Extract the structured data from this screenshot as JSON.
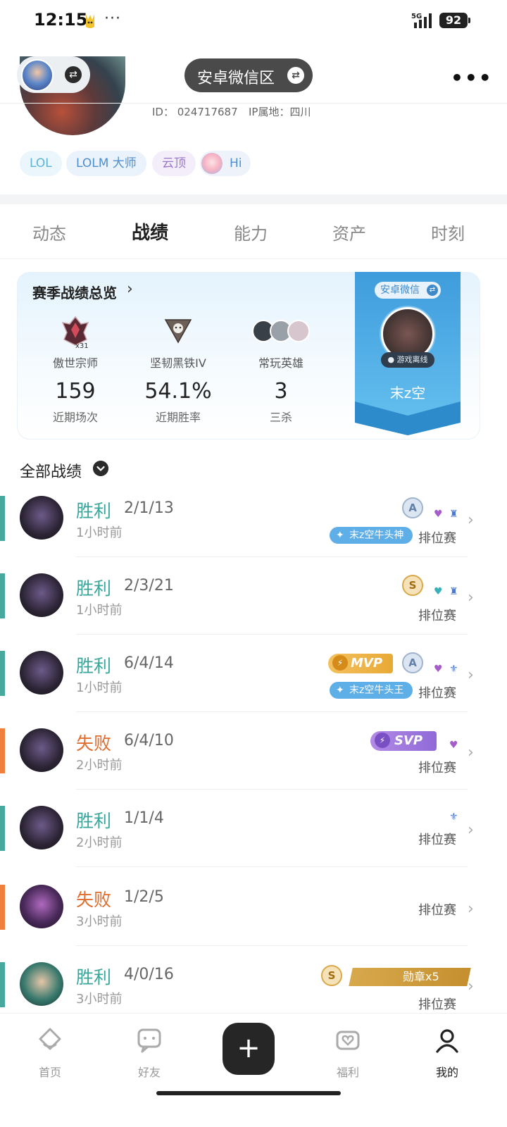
{
  "status_bar": {
    "time": "12:15",
    "dots": "···",
    "network": "5G",
    "battery": "92"
  },
  "header": {
    "region": "安卓微信区",
    "switch_icon": "swap-icon",
    "more": "•••",
    "id_text": "ID： 024717687",
    "ip_text": "IP属地：四川"
  },
  "tags": [
    {
      "label": "LOL"
    },
    {
      "label": "LOLM 大师"
    },
    {
      "label": "云顶"
    },
    {
      "label": "Hi"
    }
  ],
  "tabs": [
    {
      "label": "动态",
      "active": false
    },
    {
      "label": "战绩",
      "active": true
    },
    {
      "label": "能力",
      "active": false
    },
    {
      "label": "资产",
      "active": false
    },
    {
      "label": "时刻",
      "active": false
    }
  ],
  "season": {
    "title": "赛季战绩总览",
    "arrow": "›",
    "rank_count": "x31",
    "stats": [
      {
        "name": "傲世宗师",
        "value": "159",
        "sub": "近期场次"
      },
      {
        "name": "坚韧黑铁IV",
        "value": "54.1%",
        "sub": "近期胜率"
      },
      {
        "name": "常玩英雄",
        "value": "3",
        "sub": "三杀"
      }
    ],
    "banner": {
      "region": "安卓微信",
      "status": "● 游戏离线",
      "name": "末z空"
    },
    "colors": {
      "banner": "#4aa6e0",
      "card_bg": "#e4f3fd"
    }
  },
  "records": {
    "title": "全部战绩",
    "matches": [
      {
        "result": "胜利",
        "kda": "2/1/13",
        "ago": "1小时前",
        "mode": "排位赛",
        "grade": "A",
        "badge_text": "末z空牛头神"
      },
      {
        "result": "胜利",
        "kda": "2/3/21",
        "ago": "1小时前",
        "mode": "排位赛",
        "grade": "S"
      },
      {
        "result": "胜利",
        "kda": "6/4/14",
        "ago": "1小时前",
        "mode": "排位赛",
        "grade": "A",
        "mvp": "MVP",
        "badge_text": "末z空牛头王"
      },
      {
        "result": "失败",
        "kda": "6/4/10",
        "ago": "2小时前",
        "mode": "排位赛",
        "svp": "SVP"
      },
      {
        "result": "胜利",
        "kda": "1/1/4",
        "ago": "2小时前",
        "mode": "排位赛"
      },
      {
        "result": "失败",
        "kda": "1/2/5",
        "ago": "3小时前",
        "mode": "排位赛"
      },
      {
        "result": "胜利",
        "kda": "4/0/16",
        "ago": "3小时前",
        "mode": "排位赛",
        "grade": "S",
        "medal": "勋章x5"
      }
    ],
    "colors": {
      "win": "#3aa59b",
      "lose": "#e26d2c"
    }
  },
  "bottom_nav": [
    {
      "label": "首页",
      "icon": "home-icon"
    },
    {
      "label": "好友",
      "icon": "chat-icon"
    },
    {
      "label": "+",
      "icon": "plus-icon"
    },
    {
      "label": "福利",
      "icon": "gift-icon"
    },
    {
      "label": "我的",
      "icon": "profile-icon"
    }
  ]
}
